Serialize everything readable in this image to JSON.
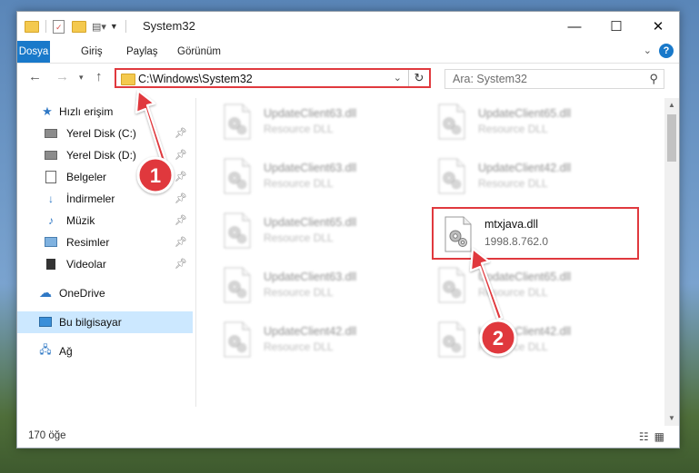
{
  "titlebar": {
    "title": "System32",
    "minimize": "—",
    "maximize": "☐",
    "close": "✕"
  },
  "ribbon": {
    "tabs": [
      "Dosya",
      "Giriş",
      "Paylaş",
      "Görünüm"
    ]
  },
  "address": {
    "path": "C:\\Windows\\System32"
  },
  "search": {
    "placeholder": "Ara: System32"
  },
  "sidebar": {
    "quick_access": "Hızlı erişim",
    "items": [
      "Yerel Disk (C:)",
      "Yerel Disk (D:)",
      "Belgeler",
      "İndirmeler",
      "Müzik",
      "Resimler",
      "Videolar"
    ],
    "onedrive": "OneDrive",
    "this_pc": "Bu bilgisayar",
    "network": "Ağ"
  },
  "files": [
    {
      "name": "UpdateClient63.dll",
      "type": "Resource DLL"
    },
    {
      "name": "UpdateClient65.dll",
      "type": "Resource DLL"
    },
    {
      "name": "UpdateClient63.dll",
      "type": "Resource DLL"
    },
    {
      "name": "UpdateClient42.dll",
      "type": "Resource DLL"
    },
    {
      "name": "UpdateClient65.dll",
      "type": "Resource DLL"
    },
    {
      "name": "mtxjava.dll",
      "version": "1998.8.762.0"
    },
    {
      "name": "UpdateClient63.dll",
      "type": "Resource DLL"
    },
    {
      "name": "UpdateClient65.dll",
      "type": "Resource DLL"
    },
    {
      "name": "UpdateClient42.dll",
      "type": "Resource DLL"
    },
    {
      "name": "UpdateClient42.dll",
      "type": "Resource DLL"
    }
  ],
  "status": {
    "count": "170 öğe"
  },
  "annotations": {
    "step1": "1",
    "step2": "2"
  },
  "colors": {
    "accent": "#1979ca",
    "highlight": "#e0393e",
    "selected": "#cce8ff"
  }
}
